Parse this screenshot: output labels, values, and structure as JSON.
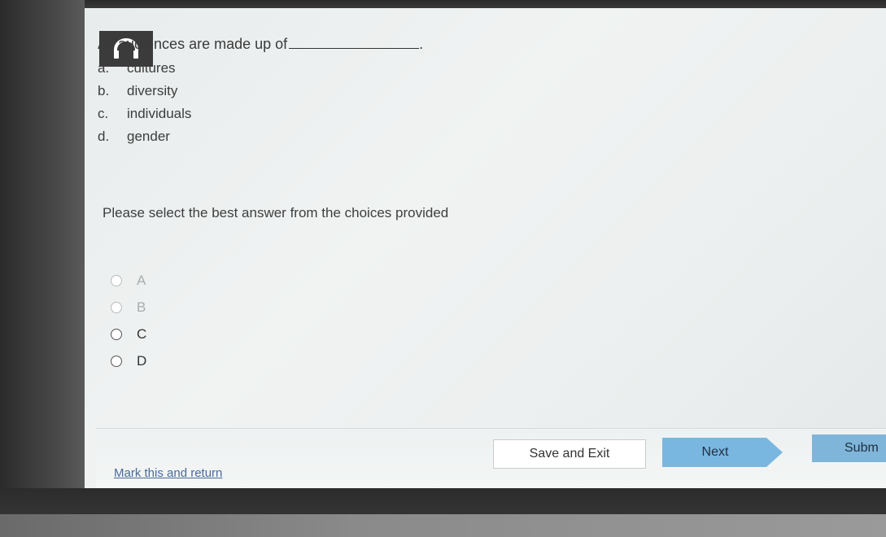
{
  "question": {
    "text": "All audiences are made up of",
    "suffix": "."
  },
  "choices": [
    {
      "letter": "a.",
      "label": "cultures"
    },
    {
      "letter": "b.",
      "label": "diversity"
    },
    {
      "letter": "c.",
      "label": "individuals"
    },
    {
      "letter": "d.",
      "label": "gender"
    }
  ],
  "prompt": "Please select the best answer from the choices provided",
  "answer_options": [
    {
      "label": "A"
    },
    {
      "label": "B"
    },
    {
      "label": "C"
    },
    {
      "label": "D"
    }
  ],
  "footer": {
    "mark_link": "Mark this and return",
    "save_exit": "Save and Exit",
    "next": "Next",
    "submit": "Subm"
  },
  "colors": {
    "next_button": "#79b7e0",
    "submit_button": "#7fb5d9",
    "link": "#4a6a9a",
    "audio_tile": "#3b3b3b"
  },
  "icons": {
    "audio": "headphones-icon"
  }
}
